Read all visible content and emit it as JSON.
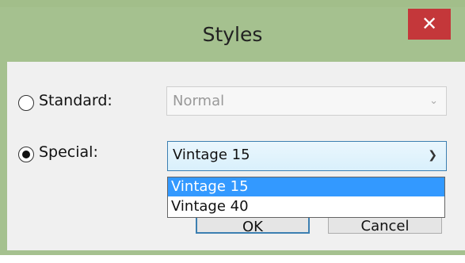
{
  "window": {
    "title": "Styles",
    "close_glyph": "✕"
  },
  "options": {
    "standard": {
      "label": "Standard:",
      "selected": false,
      "value": "Normal",
      "enabled": false
    },
    "special": {
      "label": "Special:",
      "selected": true,
      "value": "Vintage 15",
      "enabled": true
    }
  },
  "dropdown": {
    "items": [
      "Vintage 15",
      "Vintage 40"
    ],
    "highlighted": "Vintage 15"
  },
  "buttons": {
    "ok_label": "OK",
    "cancel_label": "Cancel"
  },
  "colors": {
    "titlebar": "#a5c18f",
    "close_button": "#c4373a",
    "selection": "#3399ff"
  },
  "icons": {
    "close": "close-icon",
    "combo_arrow": "chevron-down-icon"
  }
}
